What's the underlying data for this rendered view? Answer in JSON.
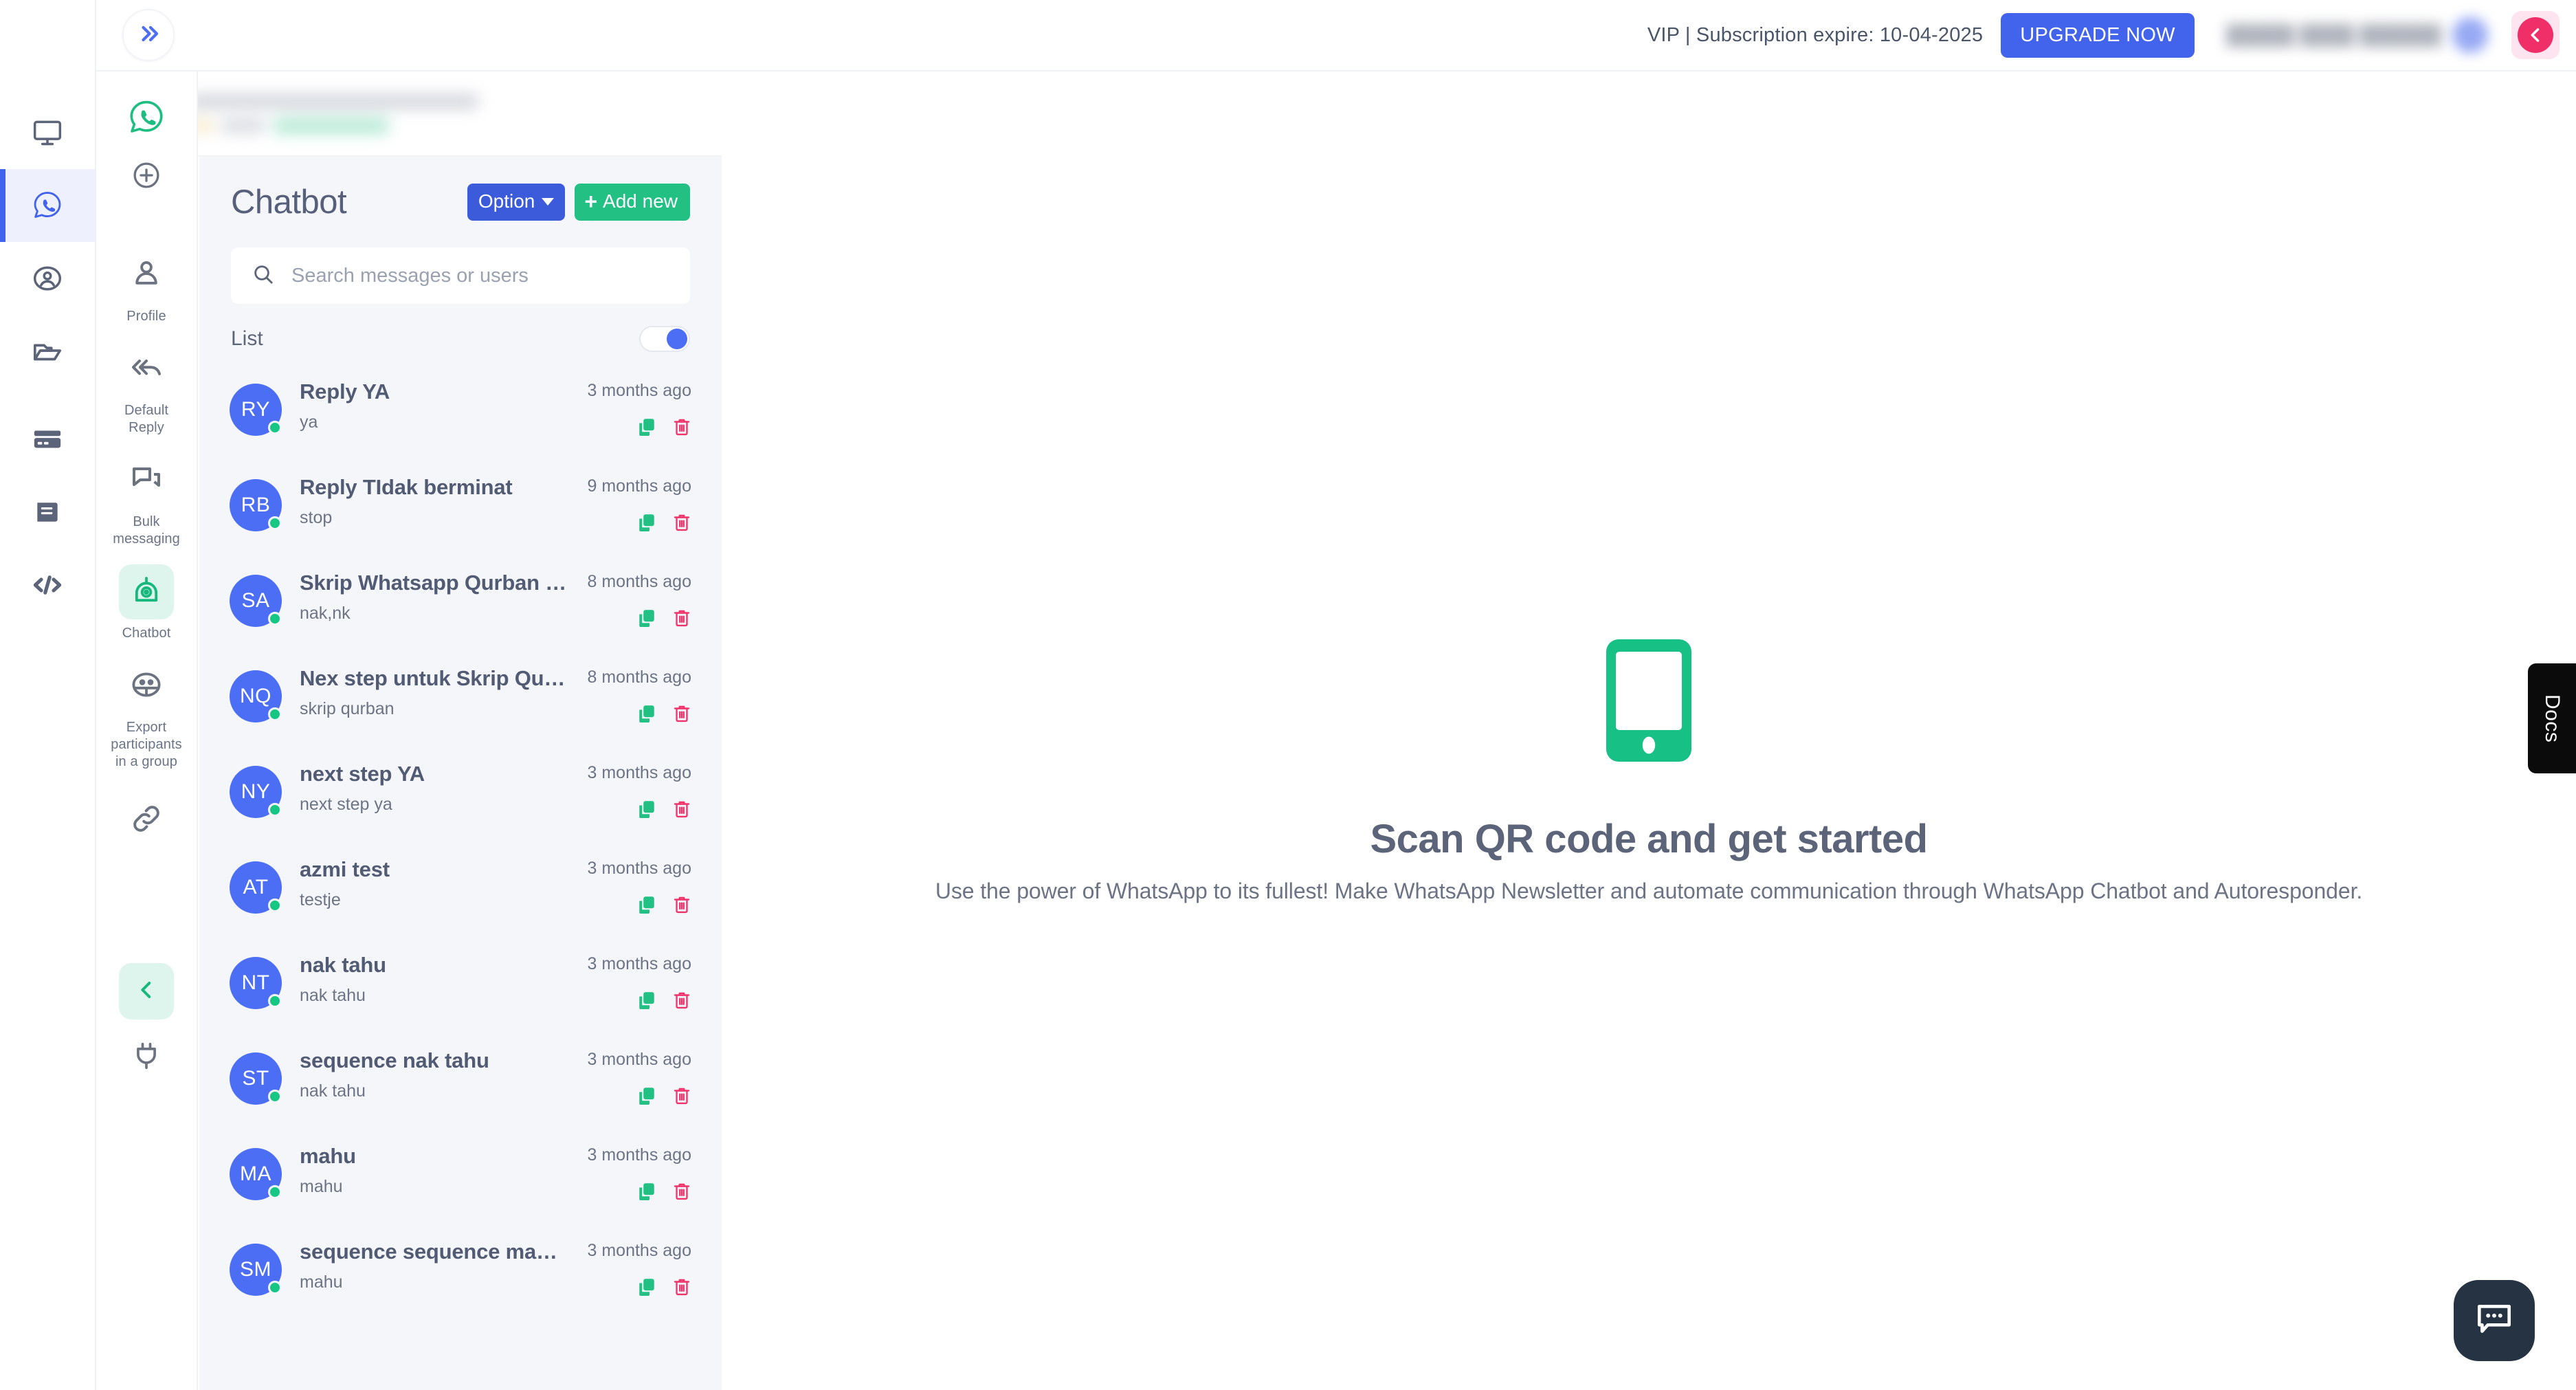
{
  "topbar": {
    "expand_icon": "double-chevron-right-icon",
    "vip_text": "VIP | Subscription expire: 10-04-2025",
    "upgrade_label": "UPGRADE NOW",
    "user_name_blurred": "█████ ████ ██████",
    "back_icon": "chevron-left-icon"
  },
  "rail": {
    "items": [
      {
        "icon": "monitor-icon",
        "active": false
      },
      {
        "icon": "whatsapp-icon",
        "active": true
      },
      {
        "icon": "user-circle-icon",
        "active": false
      },
      {
        "icon": "folder-icon",
        "active": false
      },
      {
        "icon": "credit-card-icon",
        "active": false
      },
      {
        "icon": "book-icon",
        "active": false
      },
      {
        "icon": "code-icon",
        "active": false
      }
    ]
  },
  "sidebar": {
    "logo_icon": "whatsapp-green-icon",
    "add_icon": "plus-circle-icon",
    "items": [
      {
        "label": "Profile",
        "icon": "person-icon",
        "active": false
      },
      {
        "label": "Default Reply",
        "icon": "reply-all-icon",
        "active": false
      },
      {
        "label": "Bulk messaging",
        "icon": "chat-bubbles-icon",
        "active": false
      },
      {
        "label": "Chatbot",
        "icon": "robot-icon",
        "active": true
      },
      {
        "label": "Export participants in a group",
        "icon": "group-icon",
        "active": false
      }
    ],
    "link_icon": "link-icon",
    "collapse_icon": "chevron-left-icon",
    "plug_icon": "plug-icon"
  },
  "panel": {
    "title": "Chatbot",
    "option_label": "Option",
    "add_new_label": "Add new",
    "search_placeholder": "Search messages or users",
    "search_value": "",
    "search_icon": "search-icon",
    "list_label": "List",
    "list_toggle_on": true,
    "copy_icon": "copy-icon",
    "delete_icon": "trash-icon",
    "items": [
      {
        "initials": "RY",
        "title": "Reply YA",
        "subtitle": "ya",
        "time": "3 months ago"
      },
      {
        "initials": "RB",
        "title": "Reply TIdak berminat",
        "subtitle": "stop",
        "time": "9 months ago"
      },
      {
        "initials": "SA",
        "title": "Skrip Whatsapp Qurban …",
        "subtitle": "nak,nk",
        "time": "8 months ago"
      },
      {
        "initials": "NQ",
        "title": "Nex step untuk Skrip Qur…",
        "subtitle": "skrip qurban",
        "time": "8 months ago"
      },
      {
        "initials": "NY",
        "title": "next step YA",
        "subtitle": "next step ya",
        "time": "3 months ago"
      },
      {
        "initials": "AT",
        "title": "azmi test",
        "subtitle": "testje",
        "time": "3 months ago"
      },
      {
        "initials": "NT",
        "title": "nak tahu",
        "subtitle": "nak tahu",
        "time": "3 months ago"
      },
      {
        "initials": "ST",
        "title": "sequence nak tahu",
        "subtitle": "nak tahu",
        "time": "3 months ago"
      },
      {
        "initials": "MA",
        "title": "mahu",
        "subtitle": "mahu",
        "time": "3 months ago"
      },
      {
        "initials": "SM",
        "title": "sequence sequence ma…",
        "subtitle": "mahu",
        "time": "3 months ago"
      }
    ]
  },
  "main": {
    "phone_icon": "phone-icon",
    "title": "Scan QR code and get started",
    "subtitle": "Use the power of WhatsApp to its fullest! Make WhatsApp Newsletter and automate communication through WhatsApp Chatbot and Autoresponder."
  },
  "docs_tab": {
    "label": "Docs"
  },
  "fab": {
    "icon": "chat-bubble-dots-icon"
  },
  "colors": {
    "accent_blue": "#4263eb",
    "brand_green": "#22c083",
    "danger_pink": "#f02e68",
    "panel_bg": "#f4f6fa",
    "avatar_blue": "#4c6ef5",
    "status_green": "#16c784",
    "text_primary": "#515b73",
    "text_muted": "#6c7485"
  }
}
